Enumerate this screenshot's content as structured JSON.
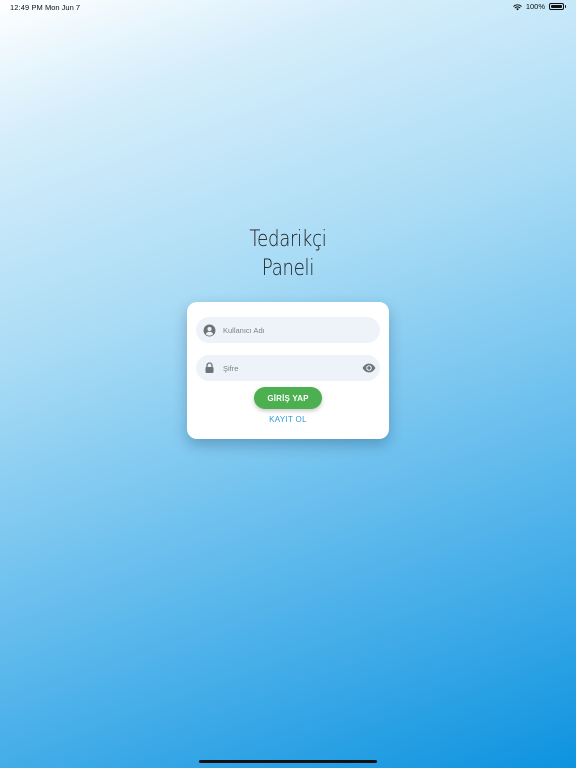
{
  "status_bar": {
    "time": "12:49 PM",
    "date": "Mon Jun 7",
    "battery": "100%",
    "battery_level": 1.0,
    "wifi_icon": "wifi-icon",
    "battery_icon": "battery-icon"
  },
  "title": {
    "line1": "Tedarikçi",
    "line2": "Paneli"
  },
  "login": {
    "username_placeholder": "Kullanıcı Adı",
    "username_value": "",
    "username_icon": "user-circle-icon",
    "password_placeholder": "Şifre",
    "password_value": "",
    "password_icon": "lock-icon",
    "visibility_icon": "eye-icon",
    "submit_label": "GİRİŞ YAP",
    "register_label": "KAYIT OL"
  },
  "colors": {
    "primary_button": "#4caf50",
    "link": "#2f9ad8",
    "field_background": "#edf3f8",
    "gradient_start": "#ffffff",
    "gradient_end": "#0d93df"
  }
}
